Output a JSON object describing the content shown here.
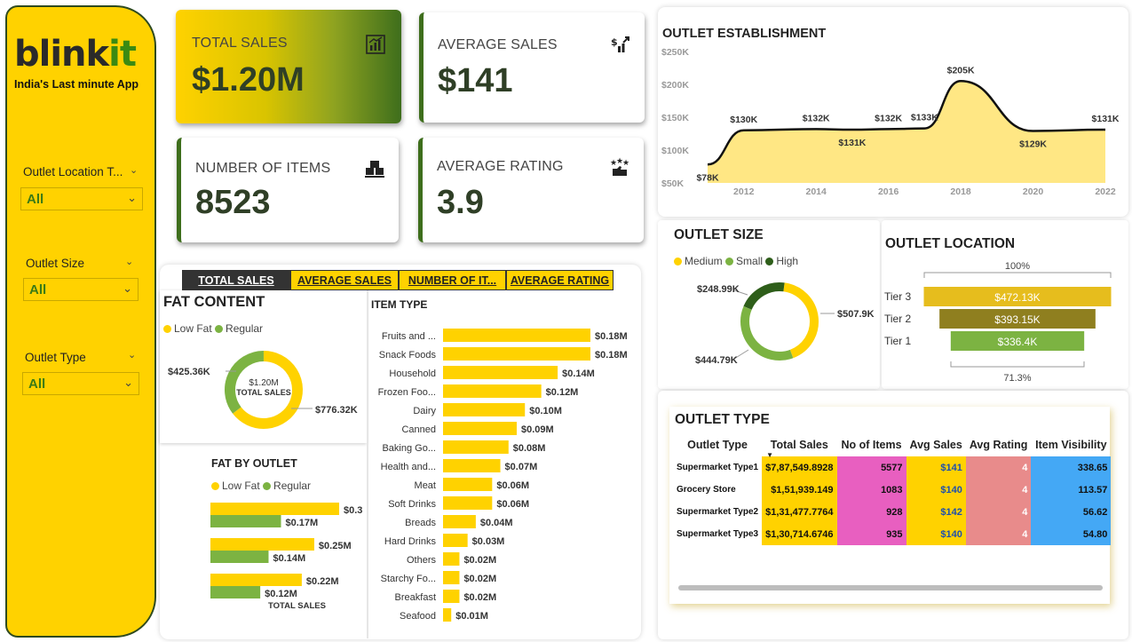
{
  "brand": {
    "name_main": "blink",
    "name_accent": "it",
    "tagline": "India's Last minute App"
  },
  "slicers": [
    {
      "title": "Outlet Location T...",
      "value": "All"
    },
    {
      "title": "Outlet Size",
      "value": "All"
    },
    {
      "title": "Outlet Type",
      "value": "All"
    }
  ],
  "kpis": {
    "total_sales": {
      "title": "TOTAL SALES",
      "value": "$1.20M",
      "icon": "sales-chart-icon"
    },
    "average_sales": {
      "title": "AVERAGE SALES",
      "value": "$141",
      "icon": "dollar-growth-icon"
    },
    "number_of_items": {
      "title": "NUMBER OF ITEMS",
      "value": "8523",
      "icon": "boxes-icon"
    },
    "average_rating": {
      "title": "AVERAGE RATING",
      "value": "3.9",
      "icon": "rating-stars-icon"
    }
  },
  "tabs": [
    "TOTAL SALES",
    "AVERAGE SALES",
    "NUMBER OF IT...",
    "AVERAGE RATING"
  ],
  "colors": {
    "yellow": "#FFD200",
    "green_light": "#7cb342",
    "green_dark": "#2e5e1a",
    "olive": "#3e6e1c"
  },
  "chart_data": [
    {
      "id": "outlet_establishment",
      "type": "area",
      "title": "OUTLET ESTABLISHMENT",
      "x": [
        2011,
        2012,
        2014,
        2015,
        2016,
        2017,
        2018,
        2020,
        2022
      ],
      "values": [
        78,
        130,
        132,
        131,
        132,
        133,
        205,
        129,
        131
      ],
      "labels": [
        "$78K",
        "$130K",
        "$132K",
        "$131K",
        "$132K",
        "$133K",
        "$205K",
        "$129K",
        "$131K"
      ],
      "ylim": [
        50,
        250
      ],
      "yticks": [
        "$250K",
        "$200K",
        "$150K",
        "$100K",
        "$50K"
      ],
      "xticks": [
        "2012",
        "2014",
        "2016",
        "2018",
        "2020",
        "2022"
      ]
    },
    {
      "id": "fat_content",
      "type": "pie",
      "title": "FAT CONTENT",
      "series": [
        {
          "name": "Low Fat",
          "value": 776.32,
          "label": "$776.32K"
        },
        {
          "name": "Regular",
          "value": 425.36,
          "label": "$425.36K"
        }
      ],
      "center_value": "$1.20M",
      "center_label": "TOTAL SALES"
    },
    {
      "id": "fat_by_outlet",
      "type": "bar",
      "title": "FAT BY OUTLET",
      "legend": [
        "Low Fat",
        "Regular"
      ],
      "groups": [
        {
          "low": 0.31,
          "regular": 0.17,
          "low_label": "$0.3",
          "regular_label": "$0.17M"
        },
        {
          "low": 0.25,
          "regular": 0.14,
          "low_label": "$0.25M",
          "regular_label": "$0.14M"
        },
        {
          "low": 0.22,
          "regular": 0.12,
          "low_label": "$0.22M",
          "regular_label": "$0.12M"
        }
      ],
      "xlabel": "TOTAL SALES"
    },
    {
      "id": "item_type",
      "type": "bar",
      "title": "ITEM TYPE",
      "categories": [
        "Fruits and ...",
        "Snack Foods",
        "Household",
        "Frozen Foo...",
        "Dairy",
        "Canned",
        "Baking Go...",
        "Health and...",
        "Meat",
        "Soft Drinks",
        "Breads",
        "Hard Drinks",
        "Others",
        "Starchy Fo...",
        "Breakfast",
        "Seafood"
      ],
      "values": [
        0.18,
        0.18,
        0.14,
        0.12,
        0.1,
        0.09,
        0.08,
        0.07,
        0.06,
        0.06,
        0.04,
        0.03,
        0.02,
        0.02,
        0.02,
        0.01
      ],
      "labels": [
        "$0.18M",
        "$0.18M",
        "$0.14M",
        "$0.12M",
        "$0.10M",
        "$0.09M",
        "$0.08M",
        "$0.07M",
        "$0.06M",
        "$0.06M",
        "$0.04M",
        "$0.03M",
        "$0.02M",
        "$0.02M",
        "$0.02M",
        "$0.01M"
      ]
    },
    {
      "id": "outlet_size",
      "type": "pie",
      "title": "OUTLET SIZE",
      "series": [
        {
          "name": "Medium",
          "value": 507.9,
          "label": "$507.9K"
        },
        {
          "name": "Small",
          "value": 444.79,
          "label": "$444.79K"
        },
        {
          "name": "High",
          "value": 248.99,
          "label": "$248.99K"
        }
      ]
    },
    {
      "id": "outlet_location",
      "type": "bar",
      "title": "OUTLET LOCATION",
      "categories": [
        "Tier 3",
        "Tier 2",
        "Tier 1"
      ],
      "values": [
        472.13,
        393.15,
        336.4
      ],
      "labels": [
        "$472.13K",
        "$393.15K",
        "$336.4K"
      ],
      "top_label": "100%",
      "bottom_label": "71.3%"
    },
    {
      "id": "outlet_type",
      "type": "table",
      "title": "OUTLET TYPE",
      "columns": [
        "Outlet Type",
        "Total Sales",
        "No of Items",
        "Avg Sales",
        "Avg Rating",
        "Item Visibility"
      ],
      "rows": [
        [
          "Supermarket Type1",
          "$7,87,549.8928",
          "5577",
          "$141",
          "4",
          "338.65"
        ],
        [
          "Grocery Store",
          "$1,51,939.149",
          "1083",
          "$140",
          "4",
          "113.57"
        ],
        [
          "Supermarket Type2",
          "$1,31,477.7764",
          "928",
          "$142",
          "4",
          "56.62"
        ],
        [
          "Supermarket Type3",
          "$1,30,714.6746",
          "935",
          "$140",
          "4",
          "54.80"
        ]
      ]
    }
  ]
}
